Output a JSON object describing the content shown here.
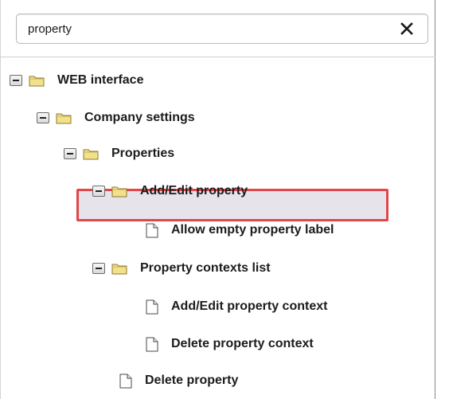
{
  "search": {
    "value": "property",
    "clear_glyph": "✕"
  },
  "tree": {
    "rows": [
      {
        "label": "WEB interface",
        "type": "folder",
        "expanded": true
      },
      {
        "label": "Company settings",
        "type": "folder",
        "expanded": true
      },
      {
        "label": "Properties",
        "type": "folder",
        "expanded": true
      },
      {
        "label": "Add/Edit property",
        "type": "folder",
        "expanded": true
      },
      {
        "label": "Allow empty property label",
        "type": "file"
      },
      {
        "label": "Property contexts list",
        "type": "folder",
        "expanded": true,
        "selected": true
      },
      {
        "label": "Add/Edit property context",
        "type": "file"
      },
      {
        "label": "Delete property context",
        "type": "file"
      },
      {
        "label": "Delete property",
        "type": "file"
      }
    ]
  },
  "colors": {
    "highlight_border": "#e2454a",
    "selected_bg": "#e6e4ea",
    "folder_yellow": "#f3e08a"
  }
}
